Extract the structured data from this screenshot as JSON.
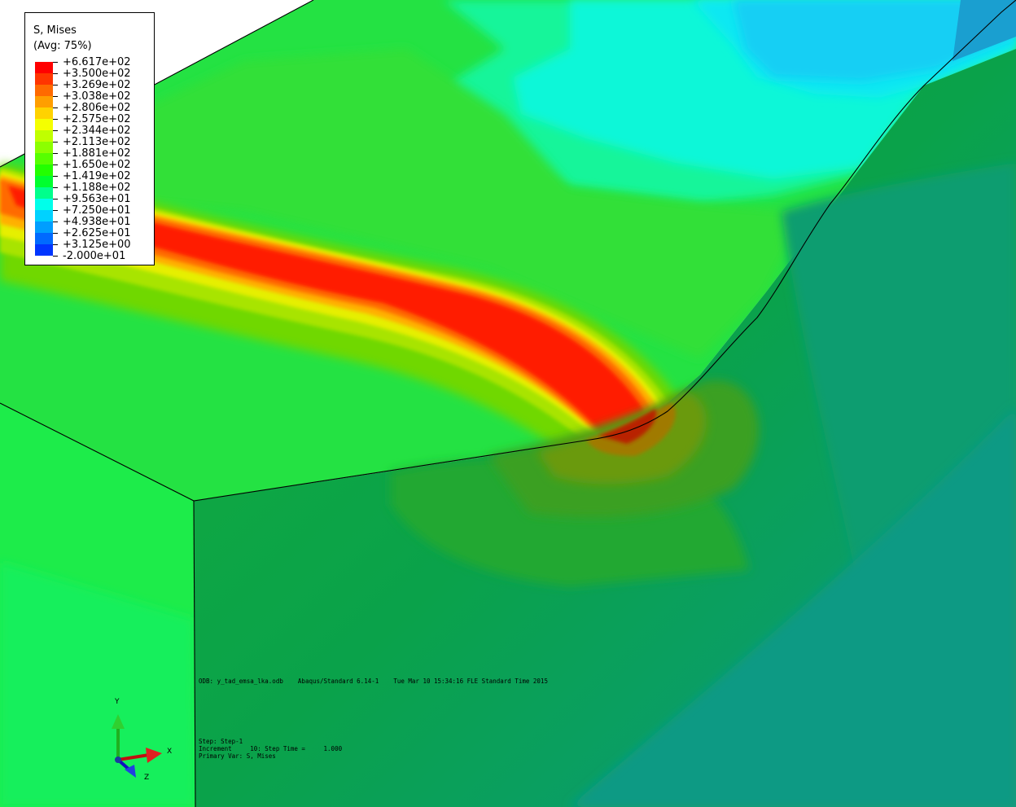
{
  "legend": {
    "title": "S, Mises",
    "subtitle": "(Avg: 75%)",
    "values": [
      "+6.617e+02",
      "+3.500e+02",
      "+3.269e+02",
      "+3.038e+02",
      "+2.806e+02",
      "+2.575e+02",
      "+2.344e+02",
      "+2.113e+02",
      "+1.881e+02",
      "+1.650e+02",
      "+1.419e+02",
      "+1.188e+02",
      "+9.563e+01",
      "+7.250e+01",
      "+4.938e+01",
      "+2.625e+01",
      "+3.125e+00",
      "-2.000e+01"
    ],
    "colors": [
      "#ff0000",
      "#ff3500",
      "#ff6a00",
      "#ff9e00",
      "#ffd200",
      "#f5ff00",
      "#c0ff00",
      "#8cff00",
      "#57ff00",
      "#23ff00",
      "#00ff2e",
      "#00ff8c",
      "#00ffea",
      "#00d2ff",
      "#009eff",
      "#006aff",
      "#0035ff"
    ]
  },
  "info": {
    "odb_line": "ODB: y_tad_emsa_lka.odb    Abaqus/Standard 6.14-1    Tue Mar 10 15:34:16 FLE Standard Time 2015",
    "step_line": "Step: Step-1",
    "increment_line": "Increment     10: Step Time =     1.000",
    "primary_var_line": "Primary Var: S, Mises"
  },
  "triad": {
    "x_label": "X",
    "y_label": "Y",
    "z_label": "Z"
  }
}
